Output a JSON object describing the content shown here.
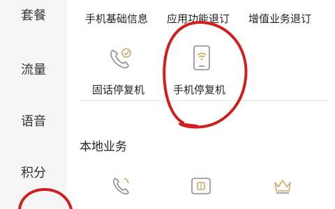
{
  "sidebar": {
    "items": [
      {
        "label": "套餐"
      },
      {
        "label": "流量"
      },
      {
        "label": "语音"
      },
      {
        "label": "积分"
      }
    ]
  },
  "top_row": {
    "items": [
      {
        "label": "手机基础信息"
      },
      {
        "label": "应用功能退订"
      },
      {
        "label": "增值业务退订"
      }
    ]
  },
  "middle_row": {
    "items": [
      {
        "label": "固话停复机",
        "icon": "landline-check-icon"
      },
      {
        "label": "手机停复机",
        "icon": "mobile-signal-icon"
      }
    ]
  },
  "local_section": {
    "title": "本地业务",
    "icons": [
      "phone-handset-icon",
      "sim-card-icon",
      "crown-icon"
    ]
  },
  "colors": {
    "sidebar_bg": "#f6f6f6",
    "icon_gold": "#c9a96a",
    "icon_gray": "#8c8c8c",
    "annotation_red": "#d11f1f"
  }
}
